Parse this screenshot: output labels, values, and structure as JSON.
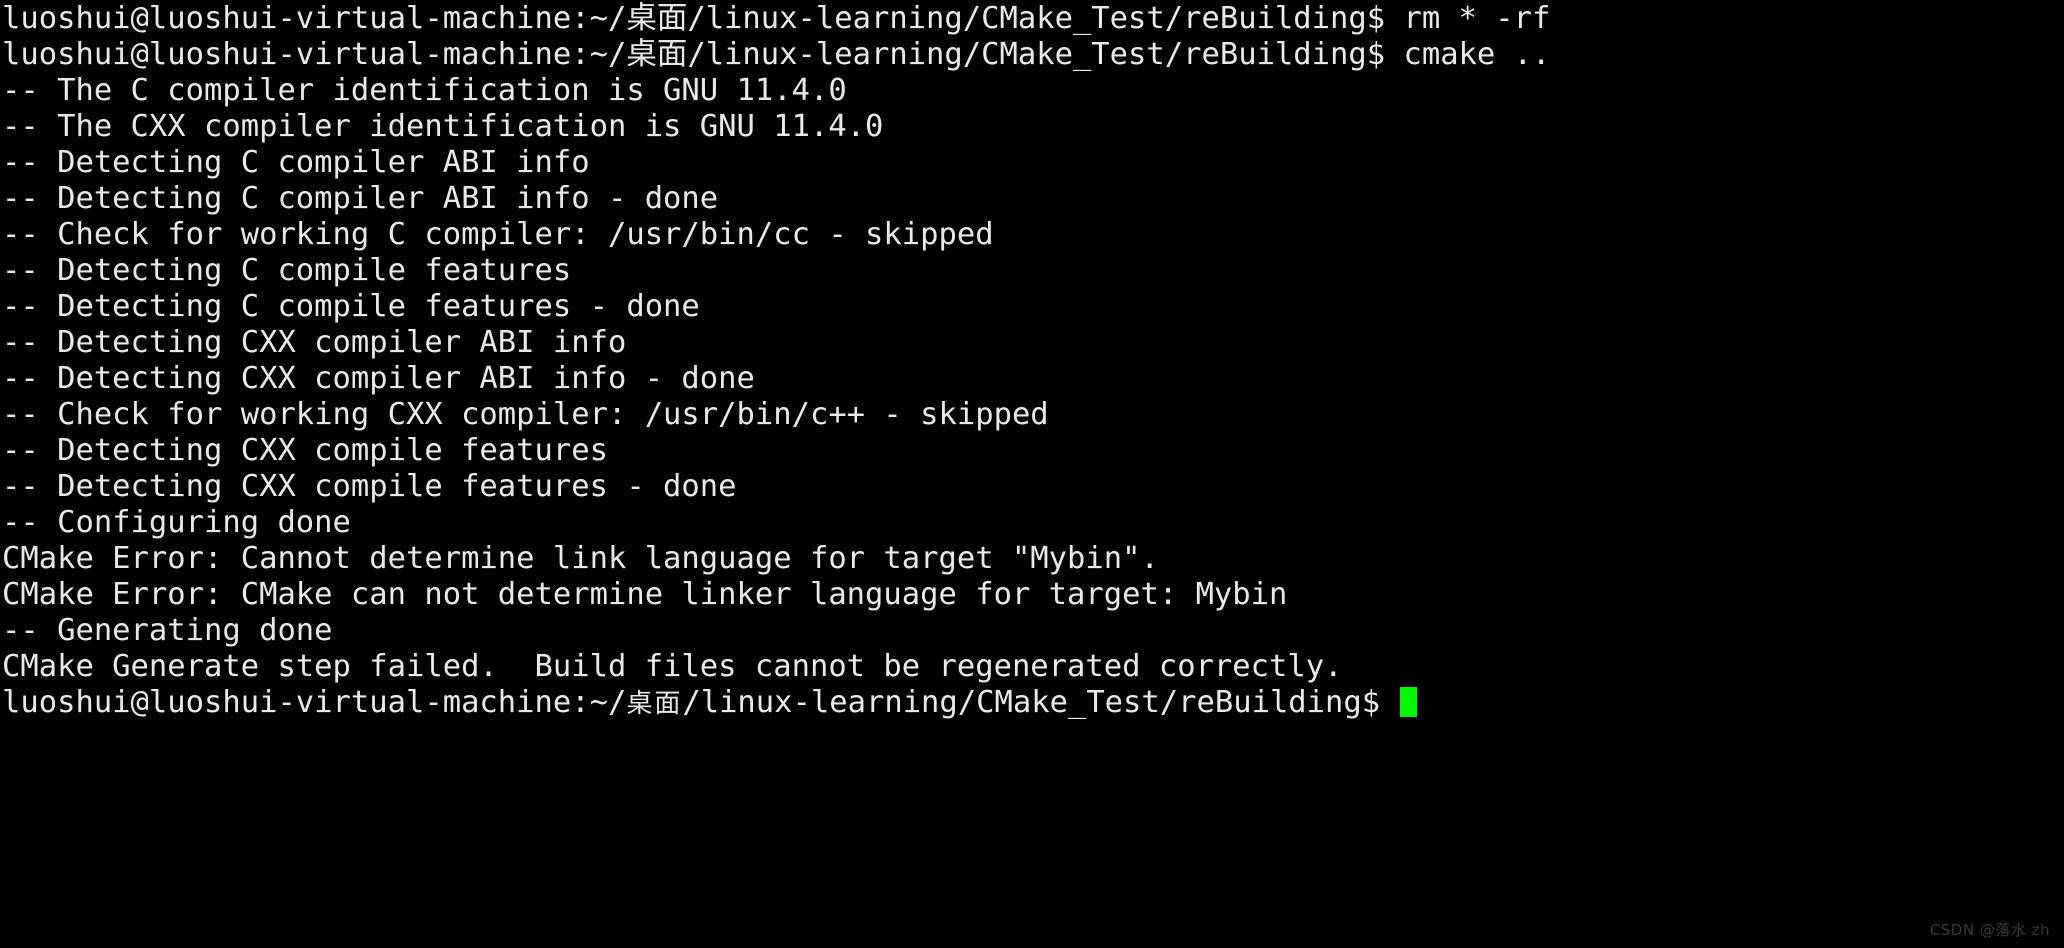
{
  "terminal": {
    "background_color": "#000000",
    "foreground_color": "#e9e9e9",
    "cursor_color": "#00f900",
    "user": "luoshui",
    "host": "luoshui-virtual-machine",
    "cwd_display": "~/桌面/linux-learning/CMake_Test/reBuilding",
    "prompt_symbol": "$",
    "lines": [
      {
        "id": "l01",
        "type": "prompt",
        "text": "luoshui@luoshui-virtual-machine:~/桌面/linux-learning/CMake_Test/reBuilding$ rm * -rf"
      },
      {
        "id": "l02",
        "type": "prompt",
        "text": "luoshui@luoshui-virtual-machine:~/桌面/linux-learning/CMake_Test/reBuilding$ cmake .."
      },
      {
        "id": "l03",
        "type": "status",
        "text": "-- The C compiler identification is GNU 11.4.0"
      },
      {
        "id": "l04",
        "type": "status",
        "text": "-- The CXX compiler identification is GNU 11.4.0"
      },
      {
        "id": "l05",
        "type": "status",
        "text": "-- Detecting C compiler ABI info"
      },
      {
        "id": "l06",
        "type": "status",
        "text": "-- Detecting C compiler ABI info - done"
      },
      {
        "id": "l07",
        "type": "status",
        "text": "-- Check for working C compiler: /usr/bin/cc - skipped"
      },
      {
        "id": "l08",
        "type": "status",
        "text": "-- Detecting C compile features"
      },
      {
        "id": "l09",
        "type": "status",
        "text": "-- Detecting C compile features - done"
      },
      {
        "id": "l10",
        "type": "status",
        "text": "-- Detecting CXX compiler ABI info"
      },
      {
        "id": "l11",
        "type": "status",
        "text": "-- Detecting CXX compiler ABI info - done"
      },
      {
        "id": "l12",
        "type": "status",
        "text": "-- Check for working CXX compiler: /usr/bin/c++ - skipped"
      },
      {
        "id": "l13",
        "type": "status",
        "text": "-- Detecting CXX compile features"
      },
      {
        "id": "l14",
        "type": "status",
        "text": "-- Detecting CXX compile features - done"
      },
      {
        "id": "l15",
        "type": "status",
        "text": "-- Configuring done"
      },
      {
        "id": "l16",
        "type": "error",
        "text": "CMake Error: Cannot determine link language for target \"Mybin\"."
      },
      {
        "id": "l17",
        "type": "error",
        "text": "CMake Error: CMake can not determine linker language for target: Mybin"
      },
      {
        "id": "l18",
        "type": "status",
        "text": "-- Generating done"
      },
      {
        "id": "l19",
        "type": "error",
        "text": "CMake Generate step failed.  Build files cannot be regenerated correctly."
      }
    ],
    "last_prompt": {
      "prefix": "luoshui@luoshui-virtual-machine:~/",
      "cjk": "桌面",
      "suffix": "/linux-learning/CMake_Test/reBuilding$ ",
      "cursor": "block-cursor"
    },
    "commands_entered": [
      "rm * -rf",
      "cmake .."
    ]
  },
  "watermark": {
    "text": "CSDN @落水 zh"
  }
}
